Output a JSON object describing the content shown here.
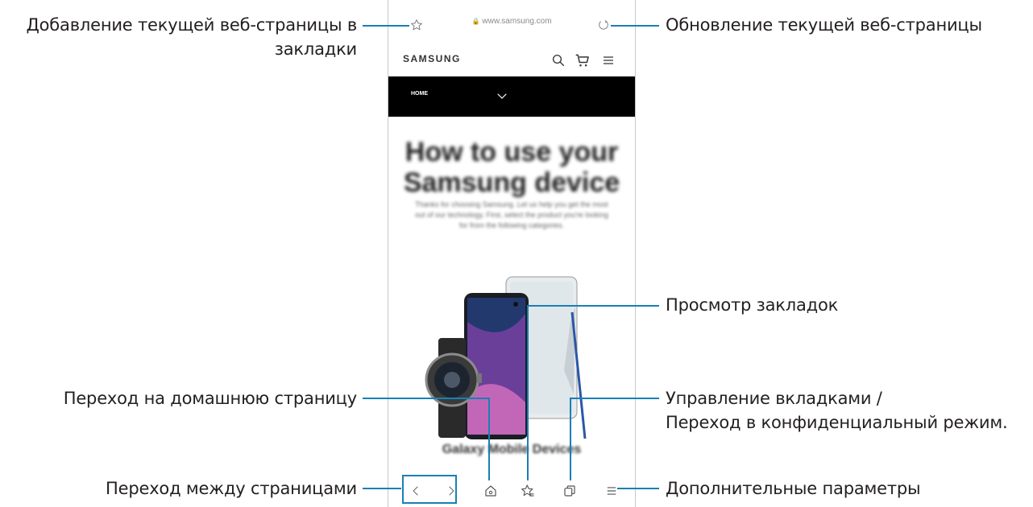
{
  "browser": {
    "url": "www.samsung.com",
    "site_logo": "SAMSUNG",
    "nav_home_label": "HOME",
    "hero_title_line1": "How to use your",
    "hero_title_line2": "Samsung device",
    "hero_text": "Thanks for choosing Samsung. Let us help you get the most out of our technology. First, select the product you're looking for from the following categories.",
    "section_title": "Galaxy Mobile Devices"
  },
  "callouts": {
    "add_bookmark": "Добавление текущей веб-страницы в",
    "add_bookmark_line2": "закладки",
    "refresh": "Обновление текущей веб-страницы",
    "view_bookmarks": "Просмотр закладок",
    "home": "Переход на домашнюю страницу",
    "tabs_line1": "Управление вкладками /",
    "tabs_line2": "Переход в конфиденциальный режим.",
    "navigate": "Переход между страницами",
    "more": "Дополнительные параметры"
  },
  "icons": {
    "star": "star-icon",
    "lock": "lock-icon",
    "refresh": "refresh-icon",
    "search": "search-icon",
    "cart": "cart-icon",
    "menu": "menu-icon",
    "chevron": "chevron-down-icon",
    "back": "back-icon",
    "forward": "forward-icon",
    "home": "home-icon",
    "bookmarks": "bookmarks-icon",
    "tabs": "tabs-icon",
    "more": "more-icon"
  },
  "colors": {
    "accent": "#1a7fb5"
  }
}
